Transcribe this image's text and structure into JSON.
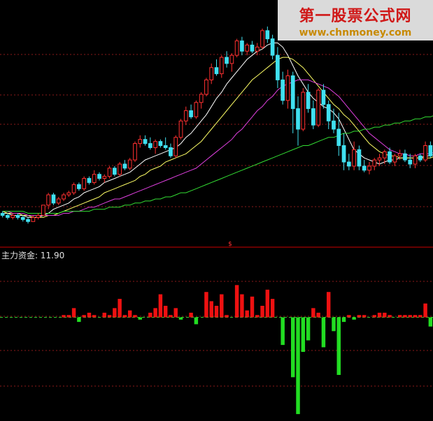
{
  "chart_data": [
    {
      "type": "candlestick",
      "ylim": [
        0,
        100
      ],
      "grid": true,
      "candles": [
        {
          "o": 9,
          "h": 10,
          "l": 7,
          "c": 8
        },
        {
          "o": 8,
          "h": 9,
          "l": 6,
          "c": 7
        },
        {
          "o": 7,
          "h": 9,
          "l": 6,
          "c": 8
        },
        {
          "o": 8,
          "h": 9,
          "l": 6,
          "c": 7
        },
        {
          "o": 7,
          "h": 8,
          "l": 5,
          "c": 6
        },
        {
          "o": 6,
          "h": 7,
          "l": 4,
          "c": 5
        },
        {
          "o": 5,
          "h": 8,
          "l": 5,
          "c": 7
        },
        {
          "o": 7,
          "h": 9,
          "l": 6,
          "c": 8
        },
        {
          "o": 8,
          "h": 13,
          "l": 8,
          "c": 13
        },
        {
          "o": 13,
          "h": 19,
          "l": 11,
          "c": 18
        },
        {
          "o": 18,
          "h": 19,
          "l": 13,
          "c": 14
        },
        {
          "o": 14,
          "h": 17,
          "l": 13,
          "c": 16
        },
        {
          "o": 16,
          "h": 19,
          "l": 15,
          "c": 18
        },
        {
          "o": 18,
          "h": 20,
          "l": 17,
          "c": 19
        },
        {
          "o": 19,
          "h": 24,
          "l": 18,
          "c": 23
        },
        {
          "o": 23,
          "h": 24,
          "l": 20,
          "c": 21
        },
        {
          "o": 21,
          "h": 27,
          "l": 20,
          "c": 26
        },
        {
          "o": 26,
          "h": 27,
          "l": 23,
          "c": 24
        },
        {
          "o": 24,
          "h": 30,
          "l": 23,
          "c": 28
        },
        {
          "o": 28,
          "h": 29,
          "l": 25,
          "c": 26
        },
        {
          "o": 26,
          "h": 28,
          "l": 24,
          "c": 27
        },
        {
          "o": 27,
          "h": 32,
          "l": 26,
          "c": 31
        },
        {
          "o": 31,
          "h": 32,
          "l": 27,
          "c": 28
        },
        {
          "o": 28,
          "h": 34,
          "l": 27,
          "c": 33
        },
        {
          "o": 33,
          "h": 35,
          "l": 30,
          "c": 31
        },
        {
          "o": 31,
          "h": 36,
          "l": 30,
          "c": 35
        },
        {
          "o": 35,
          "h": 44,
          "l": 34,
          "c": 43
        },
        {
          "o": 43,
          "h": 47,
          "l": 41,
          "c": 45
        },
        {
          "o": 45,
          "h": 47,
          "l": 42,
          "c": 43
        },
        {
          "o": 43,
          "h": 46,
          "l": 40,
          "c": 41
        },
        {
          "o": 41,
          "h": 45,
          "l": 38,
          "c": 44
        },
        {
          "o": 44,
          "h": 45,
          "l": 41,
          "c": 42
        },
        {
          "o": 42,
          "h": 46,
          "l": 40,
          "c": 41
        },
        {
          "o": 41,
          "h": 43,
          "l": 36,
          "c": 37
        },
        {
          "o": 37,
          "h": 47,
          "l": 36,
          "c": 46
        },
        {
          "o": 46,
          "h": 55,
          "l": 45,
          "c": 54
        },
        {
          "o": 54,
          "h": 61,
          "l": 52,
          "c": 59
        },
        {
          "o": 59,
          "h": 62,
          "l": 55,
          "c": 56
        },
        {
          "o": 56,
          "h": 64,
          "l": 55,
          "c": 63
        },
        {
          "o": 63,
          "h": 68,
          "l": 60,
          "c": 67
        },
        {
          "o": 67,
          "h": 75,
          "l": 66,
          "c": 74
        },
        {
          "o": 74,
          "h": 82,
          "l": 72,
          "c": 80
        },
        {
          "o": 80,
          "h": 84,
          "l": 76,
          "c": 77
        },
        {
          "o": 77,
          "h": 86,
          "l": 75,
          "c": 85
        },
        {
          "o": 85,
          "h": 88,
          "l": 80,
          "c": 82
        },
        {
          "o": 82,
          "h": 87,
          "l": 78,
          "c": 86
        },
        {
          "o": 86,
          "h": 94,
          "l": 85,
          "c": 93
        },
        {
          "o": 93,
          "h": 95,
          "l": 86,
          "c": 88
        },
        {
          "o": 88,
          "h": 92,
          "l": 86,
          "c": 91
        },
        {
          "o": 91,
          "h": 93,
          "l": 87,
          "c": 88
        },
        {
          "o": 88,
          "h": 92,
          "l": 86,
          "c": 90
        },
        {
          "o": 90,
          "h": 99,
          "l": 89,
          "c": 98
        },
        {
          "o": 98,
          "h": 100,
          "l": 92,
          "c": 94
        },
        {
          "o": 94,
          "h": 96,
          "l": 84,
          "c": 86
        },
        {
          "o": 86,
          "h": 90,
          "l": 70,
          "c": 74
        },
        {
          "o": 74,
          "h": 78,
          "l": 62,
          "c": 64
        },
        {
          "o": 64,
          "h": 79,
          "l": 60,
          "c": 76
        },
        {
          "o": 76,
          "h": 78,
          "l": 48,
          "c": 60
        },
        {
          "o": 60,
          "h": 66,
          "l": 42,
          "c": 50
        },
        {
          "o": 50,
          "h": 70,
          "l": 49,
          "c": 68
        },
        {
          "o": 68,
          "h": 72,
          "l": 58,
          "c": 60
        },
        {
          "o": 60,
          "h": 64,
          "l": 50,
          "c": 52
        },
        {
          "o": 52,
          "h": 70,
          "l": 51,
          "c": 69
        },
        {
          "o": 69,
          "h": 72,
          "l": 60,
          "c": 62
        },
        {
          "o": 62,
          "h": 64,
          "l": 50,
          "c": 54
        },
        {
          "o": 54,
          "h": 60,
          "l": 48,
          "c": 50
        },
        {
          "o": 50,
          "h": 58,
          "l": 37,
          "c": 42
        },
        {
          "o": 42,
          "h": 48,
          "l": 30,
          "c": 34
        },
        {
          "o": 34,
          "h": 38,
          "l": 30,
          "c": 32
        },
        {
          "o": 32,
          "h": 44,
          "l": 30,
          "c": 40
        },
        {
          "o": 40,
          "h": 42,
          "l": 30,
          "c": 32
        },
        {
          "o": 32,
          "h": 35,
          "l": 29,
          "c": 30
        },
        {
          "o": 30,
          "h": 34,
          "l": 28,
          "c": 32
        },
        {
          "o": 32,
          "h": 36,
          "l": 30,
          "c": 35
        },
        {
          "o": 35,
          "h": 38,
          "l": 32,
          "c": 36
        },
        {
          "o": 36,
          "h": 40,
          "l": 33,
          "c": 39
        },
        {
          "o": 39,
          "h": 41,
          "l": 33,
          "c": 34
        },
        {
          "o": 34,
          "h": 38,
          "l": 32,
          "c": 37
        },
        {
          "o": 37,
          "h": 40,
          "l": 35,
          "c": 38
        },
        {
          "o": 38,
          "h": 40,
          "l": 34,
          "c": 35
        },
        {
          "o": 35,
          "h": 38,
          "l": 31,
          "c": 33
        },
        {
          "o": 33,
          "h": 38,
          "l": 31,
          "c": 37
        },
        {
          "o": 37,
          "h": 38,
          "l": 34,
          "c": 35
        },
        {
          "o": 35,
          "h": 44,
          "l": 34,
          "c": 42
        },
        {
          "o": 42,
          "h": 44,
          "l": 36,
          "c": 37
        }
      ],
      "moving_averages": [
        {
          "color": "#ffffff",
          "values": [
            9,
            9,
            8,
            8,
            8,
            7,
            7,
            7,
            8,
            9,
            11,
            12,
            13,
            14,
            16,
            17,
            19,
            20,
            21,
            22,
            24,
            25,
            26,
            27,
            28,
            29,
            31,
            33,
            35,
            36,
            37,
            38,
            39,
            40,
            41,
            43,
            46,
            48,
            51,
            54,
            57,
            61,
            65,
            68,
            72,
            75,
            78,
            81,
            84,
            86,
            88,
            89,
            91,
            92,
            92,
            90,
            86,
            81,
            76,
            72,
            68,
            65,
            63,
            61,
            60,
            58,
            55,
            50,
            45,
            40,
            38,
            36,
            35,
            34,
            33,
            34,
            35,
            35,
            36,
            36,
            36,
            36,
            36,
            37,
            37,
            38
          ]
        },
        {
          "color": "#ffff66",
          "values": [
            10,
            9,
            9,
            9,
            8,
            8,
            7,
            7,
            7,
            8,
            8,
            9,
            10,
            11,
            12,
            13,
            14,
            15,
            16,
            17,
            19,
            20,
            21,
            22,
            23,
            24,
            25,
            27,
            28,
            30,
            31,
            32,
            34,
            35,
            36,
            37,
            38,
            40,
            42,
            44,
            47,
            50,
            53,
            56,
            59,
            62,
            65,
            68,
            71,
            74,
            76,
            78,
            80,
            82,
            84,
            85,
            85,
            84,
            82,
            80,
            77,
            74,
            71,
            68,
            65,
            62,
            60,
            57,
            55,
            52,
            49,
            46,
            43,
            41,
            39,
            38,
            37,
            37,
            36,
            36,
            36,
            36,
            36,
            36,
            36,
            37
          ]
        },
        {
          "color": "#e040e0",
          "values": [
            10,
            10,
            9,
            9,
            9,
            8,
            8,
            8,
            8,
            8,
            8,
            8,
            9,
            9,
            10,
            10,
            11,
            12,
            12,
            13,
            14,
            15,
            16,
            16,
            17,
            18,
            19,
            20,
            21,
            22,
            23,
            24,
            25,
            26,
            27,
            28,
            29,
            30,
            31,
            33,
            35,
            37,
            39,
            41,
            43,
            45,
            48,
            50,
            53,
            56,
            59,
            61,
            64,
            66,
            69,
            71,
            72,
            73,
            74,
            74,
            74,
            73,
            72,
            71,
            70,
            68,
            66,
            63,
            60,
            57,
            54,
            51,
            48,
            46,
            44,
            42,
            40,
            39,
            38,
            38,
            37,
            37,
            38,
            38,
            38,
            39
          ]
        },
        {
          "color": "#33dd33",
          "values": [
            10,
            10,
            10,
            10,
            10,
            9,
            9,
            9,
            9,
            9,
            9,
            9,
            10,
            10,
            10,
            10,
            10,
            10,
            11,
            11,
            11,
            12,
            12,
            12,
            13,
            13,
            14,
            14,
            15,
            15,
            16,
            16,
            17,
            17,
            18,
            19,
            19,
            20,
            21,
            22,
            23,
            24,
            25,
            26,
            27,
            28,
            29,
            30,
            31,
            32,
            33,
            34,
            35,
            36,
            37,
            38,
            39,
            40,
            41,
            42,
            42,
            43,
            44,
            45,
            46,
            46,
            47,
            48,
            48,
            49,
            49,
            50,
            50,
            51,
            51,
            52,
            52,
            53,
            53,
            54,
            54,
            55,
            55,
            56,
            56,
            57
          ]
        }
      ]
    },
    {
      "type": "bar",
      "title": "主力资金",
      "last_value": "11.90",
      "ylim": [
        -45,
        25
      ],
      "grid": true,
      "values": [
        0,
        0,
        0,
        0,
        0,
        0,
        0,
        0,
        0,
        0,
        0,
        0,
        1,
        1,
        4,
        -2,
        1,
        2,
        1,
        0,
        2,
        1,
        4,
        8,
        1,
        3,
        1,
        -1,
        0,
        2,
        4,
        10,
        5,
        1,
        4,
        -1,
        0,
        2,
        -3,
        0,
        11,
        7,
        5,
        10,
        1,
        0,
        14,
        10,
        3,
        9,
        1,
        5,
        12,
        8,
        0,
        -12,
        0,
        -26,
        -42,
        -15,
        -10,
        4,
        2,
        -13,
        11,
        -6,
        -25,
        -2,
        1,
        -1,
        1,
        1,
        0,
        1,
        2,
        2,
        1,
        0,
        1,
        1,
        1,
        1,
        1,
        6,
        -4
      ]
    }
  ],
  "indicator": {
    "label": "主力资金: 11.90"
  },
  "watermark": {
    "title": "第一股票公式网",
    "url": "www.chnmoney.com"
  },
  "colors": {
    "up": "#ff3030",
    "down": "#40e0f0",
    "bar_positive": "#ee1111",
    "bar_negative": "#22dd22",
    "grid": "#8b1a1a",
    "separator": "#cc0000"
  }
}
